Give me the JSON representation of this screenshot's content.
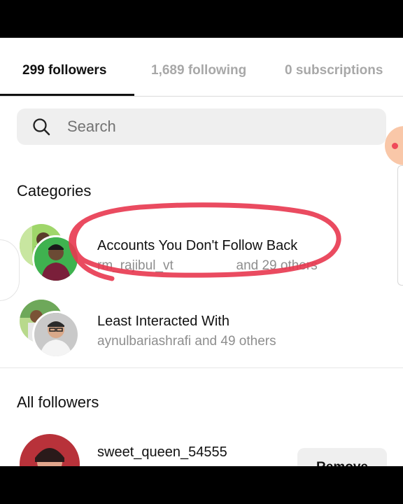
{
  "tabs": [
    {
      "label": "299 followers",
      "active": true
    },
    {
      "label": "1,689 following",
      "active": false
    },
    {
      "label": "0 subscriptions",
      "active": false
    }
  ],
  "search": {
    "placeholder": "Search",
    "icon": "search-icon"
  },
  "categories": {
    "heading": "Categories",
    "items": [
      {
        "title": "Accounts You Don't Follow Back",
        "subtitle": "rm_rajibul_vt                 and 29 others"
      },
      {
        "title": "Least Interacted With",
        "subtitle": "aynulbariashrafi and 49 others"
      }
    ]
  },
  "all_followers": {
    "heading": "All followers",
    "items": [
      {
        "username": "sweet_queen_54555",
        "action_label": "Remove"
      }
    ]
  },
  "colors": {
    "accent_annotation": "#e8374f",
    "text_primary": "#111111",
    "text_secondary": "#8e8e8e",
    "search_bg": "#efefef"
  }
}
